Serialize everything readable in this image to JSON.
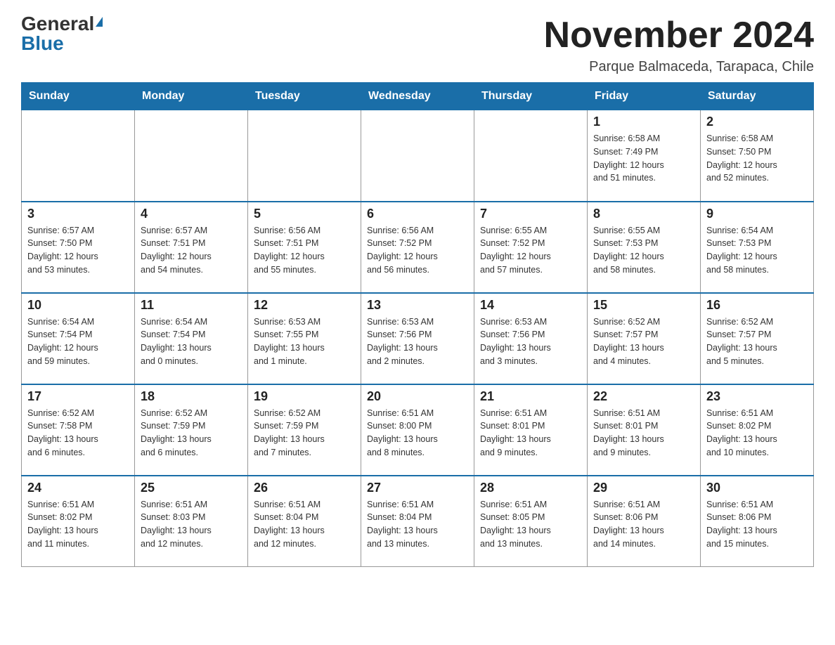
{
  "header": {
    "logo_general": "General",
    "logo_blue": "Blue",
    "month_title": "November 2024",
    "subtitle": "Parque Balmaceda, Tarapaca, Chile"
  },
  "days_of_week": [
    "Sunday",
    "Monday",
    "Tuesday",
    "Wednesday",
    "Thursday",
    "Friday",
    "Saturday"
  ],
  "weeks": [
    [
      {
        "day": "",
        "info": ""
      },
      {
        "day": "",
        "info": ""
      },
      {
        "day": "",
        "info": ""
      },
      {
        "day": "",
        "info": ""
      },
      {
        "day": "",
        "info": ""
      },
      {
        "day": "1",
        "info": "Sunrise: 6:58 AM\nSunset: 7:49 PM\nDaylight: 12 hours\nand 51 minutes."
      },
      {
        "day": "2",
        "info": "Sunrise: 6:58 AM\nSunset: 7:50 PM\nDaylight: 12 hours\nand 52 minutes."
      }
    ],
    [
      {
        "day": "3",
        "info": "Sunrise: 6:57 AM\nSunset: 7:50 PM\nDaylight: 12 hours\nand 53 minutes."
      },
      {
        "day": "4",
        "info": "Sunrise: 6:57 AM\nSunset: 7:51 PM\nDaylight: 12 hours\nand 54 minutes."
      },
      {
        "day": "5",
        "info": "Sunrise: 6:56 AM\nSunset: 7:51 PM\nDaylight: 12 hours\nand 55 minutes."
      },
      {
        "day": "6",
        "info": "Sunrise: 6:56 AM\nSunset: 7:52 PM\nDaylight: 12 hours\nand 56 minutes."
      },
      {
        "day": "7",
        "info": "Sunrise: 6:55 AM\nSunset: 7:52 PM\nDaylight: 12 hours\nand 57 minutes."
      },
      {
        "day": "8",
        "info": "Sunrise: 6:55 AM\nSunset: 7:53 PM\nDaylight: 12 hours\nand 58 minutes."
      },
      {
        "day": "9",
        "info": "Sunrise: 6:54 AM\nSunset: 7:53 PM\nDaylight: 12 hours\nand 58 minutes."
      }
    ],
    [
      {
        "day": "10",
        "info": "Sunrise: 6:54 AM\nSunset: 7:54 PM\nDaylight: 12 hours\nand 59 minutes."
      },
      {
        "day": "11",
        "info": "Sunrise: 6:54 AM\nSunset: 7:54 PM\nDaylight: 13 hours\nand 0 minutes."
      },
      {
        "day": "12",
        "info": "Sunrise: 6:53 AM\nSunset: 7:55 PM\nDaylight: 13 hours\nand 1 minute."
      },
      {
        "day": "13",
        "info": "Sunrise: 6:53 AM\nSunset: 7:56 PM\nDaylight: 13 hours\nand 2 minutes."
      },
      {
        "day": "14",
        "info": "Sunrise: 6:53 AM\nSunset: 7:56 PM\nDaylight: 13 hours\nand 3 minutes."
      },
      {
        "day": "15",
        "info": "Sunrise: 6:52 AM\nSunset: 7:57 PM\nDaylight: 13 hours\nand 4 minutes."
      },
      {
        "day": "16",
        "info": "Sunrise: 6:52 AM\nSunset: 7:57 PM\nDaylight: 13 hours\nand 5 minutes."
      }
    ],
    [
      {
        "day": "17",
        "info": "Sunrise: 6:52 AM\nSunset: 7:58 PM\nDaylight: 13 hours\nand 6 minutes."
      },
      {
        "day": "18",
        "info": "Sunrise: 6:52 AM\nSunset: 7:59 PM\nDaylight: 13 hours\nand 6 minutes."
      },
      {
        "day": "19",
        "info": "Sunrise: 6:52 AM\nSunset: 7:59 PM\nDaylight: 13 hours\nand 7 minutes."
      },
      {
        "day": "20",
        "info": "Sunrise: 6:51 AM\nSunset: 8:00 PM\nDaylight: 13 hours\nand 8 minutes."
      },
      {
        "day": "21",
        "info": "Sunrise: 6:51 AM\nSunset: 8:01 PM\nDaylight: 13 hours\nand 9 minutes."
      },
      {
        "day": "22",
        "info": "Sunrise: 6:51 AM\nSunset: 8:01 PM\nDaylight: 13 hours\nand 9 minutes."
      },
      {
        "day": "23",
        "info": "Sunrise: 6:51 AM\nSunset: 8:02 PM\nDaylight: 13 hours\nand 10 minutes."
      }
    ],
    [
      {
        "day": "24",
        "info": "Sunrise: 6:51 AM\nSunset: 8:02 PM\nDaylight: 13 hours\nand 11 minutes."
      },
      {
        "day": "25",
        "info": "Sunrise: 6:51 AM\nSunset: 8:03 PM\nDaylight: 13 hours\nand 12 minutes."
      },
      {
        "day": "26",
        "info": "Sunrise: 6:51 AM\nSunset: 8:04 PM\nDaylight: 13 hours\nand 12 minutes."
      },
      {
        "day": "27",
        "info": "Sunrise: 6:51 AM\nSunset: 8:04 PM\nDaylight: 13 hours\nand 13 minutes."
      },
      {
        "day": "28",
        "info": "Sunrise: 6:51 AM\nSunset: 8:05 PM\nDaylight: 13 hours\nand 13 minutes."
      },
      {
        "day": "29",
        "info": "Sunrise: 6:51 AM\nSunset: 8:06 PM\nDaylight: 13 hours\nand 14 minutes."
      },
      {
        "day": "30",
        "info": "Sunrise: 6:51 AM\nSunset: 8:06 PM\nDaylight: 13 hours\nand 15 minutes."
      }
    ]
  ]
}
